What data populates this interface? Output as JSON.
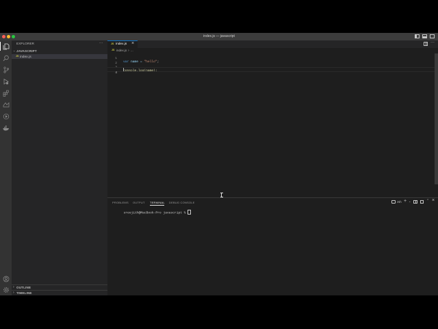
{
  "window": {
    "title": "index.js — javascript"
  },
  "colors": {
    "close": "#fe5f57",
    "minimize": "#febc2e",
    "zoom": "#28c840",
    "accent": "#0e70c0",
    "js_icon": "#cbcb41"
  },
  "activity_bar": {
    "top_icons": [
      "files-icon",
      "search-icon",
      "source-control-icon",
      "run-debug-icon",
      "extensions-icon",
      "remote-explorer-icon",
      "testing-icon",
      "docker-icon"
    ],
    "bottom_icons": [
      "account-icon",
      "manage-gear-icon"
    ]
  },
  "sidebar": {
    "header": "EXPLORER",
    "more": "···",
    "folder": "JAVASCRIPT",
    "files": [
      {
        "icon": "JS",
        "name": "index.js"
      }
    ],
    "outline": "OUTLINE",
    "timeline": "TIMELINE"
  },
  "editor": {
    "tab": {
      "icon": "JS",
      "label": "index.js",
      "close": "×"
    },
    "breadcrumb": {
      "icon": "JS",
      "file": "index.js",
      "sep": "›",
      "more": "..."
    },
    "lines": [
      {
        "num": "1",
        "keyword": "var",
        "text": " name = ",
        "string": "\"hello\"",
        "end": ";"
      },
      {
        "num": "2",
        "keyword": "",
        "text": "",
        "string": "",
        "end": ""
      },
      {
        "num": "3",
        "keyword": "",
        "text": "console.log(name);",
        "string": "",
        "end": ""
      },
      {
        "num": "4",
        "keyword": "",
        "text": "",
        "string": "",
        "end": ""
      }
    ]
  },
  "panel": {
    "tabs": [
      "PROBLEMS",
      "OUTPUT",
      "TERMINAL",
      "DEBUG CONSOLE"
    ],
    "active_tab": "TERMINAL",
    "shell": "zsh",
    "prompt": "sreejith@MacBook-Pro javascript % "
  }
}
